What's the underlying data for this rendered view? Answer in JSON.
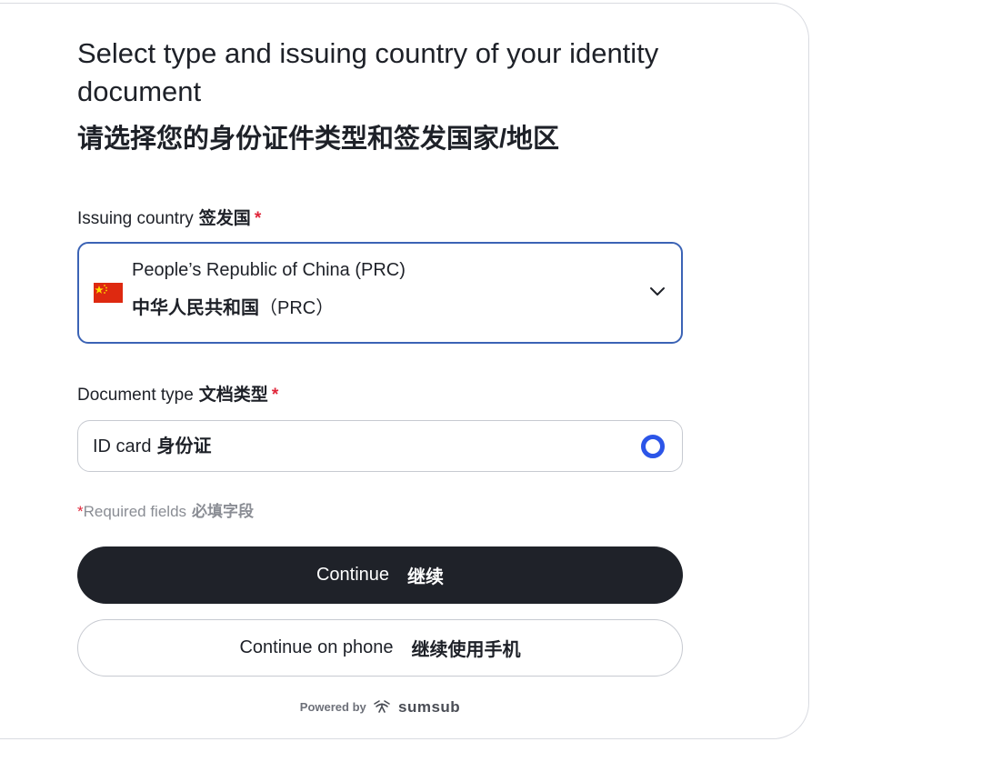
{
  "header": {
    "title_en": "Select type and issuing country of your identity document",
    "title_zh": "请选择您的身份证件类型和签发国家/地区"
  },
  "issuing_country": {
    "label_en": "Issuing country",
    "label_zh": "签发国",
    "required_mark": "*",
    "selected_en": "People’s Republic of China (PRC)",
    "selected_zh": "中华人民共和国",
    "selected_zh_suffix": "（PRC）",
    "flag_icon": "china-flag-icon",
    "dropdown_icon": "chevron-down-icon"
  },
  "document_type": {
    "label_en": "Document type",
    "label_zh": "文档类型",
    "required_mark": "*",
    "options": [
      {
        "label_en": "ID card",
        "label_zh": "身份证",
        "selected": true
      }
    ]
  },
  "required_note": {
    "star": "*",
    "text_en": "Required fields",
    "text_zh": "必填字段"
  },
  "actions": {
    "continue_en": "Continue",
    "continue_zh": "继续",
    "phone_en": "Continue on phone",
    "phone_zh": "继续使用手机"
  },
  "footer": {
    "powered_by": "Powered by",
    "brand": "sumsub"
  },
  "colors": {
    "primary_button": "#1f2229",
    "focus_border": "#3b63b5",
    "radio_accent": "#2c55e8",
    "required_star": "#e0263a"
  }
}
